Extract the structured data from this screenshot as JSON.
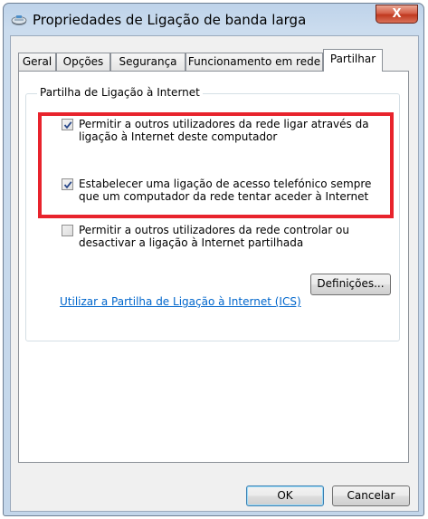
{
  "window": {
    "title": "Propriedades de Ligação de banda larga",
    "close_glyph": "X"
  },
  "tabs": [
    {
      "label": "Geral"
    },
    {
      "label": "Opções"
    },
    {
      "label": "Segurança"
    },
    {
      "label": "Funcionamento em rede"
    },
    {
      "label": "Partilhar",
      "active": true
    }
  ],
  "sharing": {
    "group_title": "Partilha de Ligação à Internet",
    "options": [
      {
        "line1": "Permitir a outros utilizadores da rede ligar através da",
        "line2": "ligação à Internet deste computador",
        "checked": true
      },
      {
        "line1": "Estabelecer uma ligação de acesso telefónico sempre",
        "line2": "que um computador da rede tentar aceder à Internet",
        "checked": true
      },
      {
        "line1": "Permitir a outros utilizadores da rede controlar ou",
        "line2": "desactivar a ligação à Internet partilhada",
        "checked": false
      }
    ],
    "ics_link": "Utilizar a Partilha de Ligação à Internet (ICS)",
    "settings_button": "Definições..."
  },
  "footer": {
    "ok": "OK",
    "cancel": "Cancelar"
  },
  "colors": {
    "highlight_box": "#e8232c",
    "link": "#0066cc"
  }
}
